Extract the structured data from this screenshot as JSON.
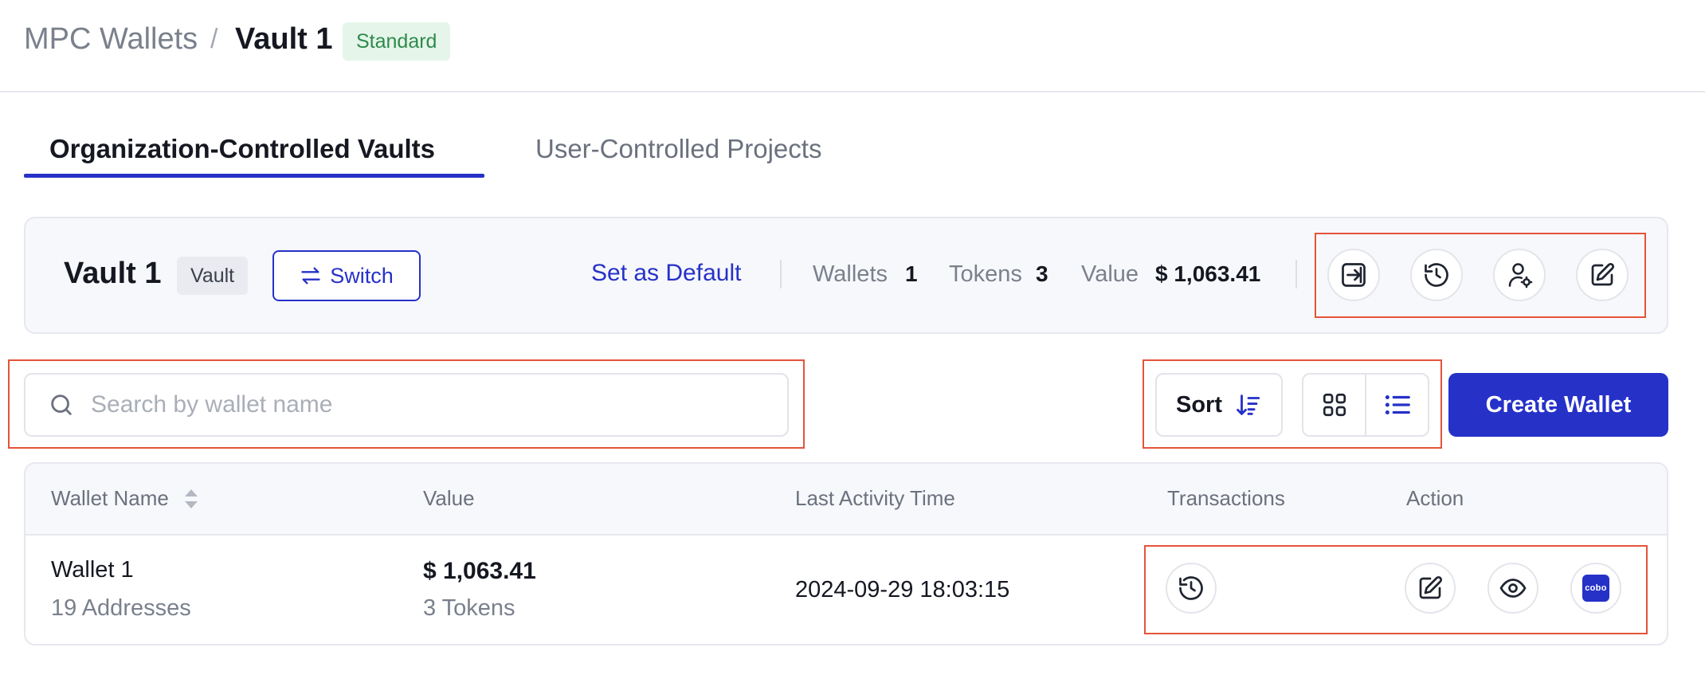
{
  "breadcrumb": {
    "root": "MPC Wallets",
    "separator": "/",
    "current": "Vault 1",
    "badge": "Standard"
  },
  "tabs": [
    {
      "label": "Organization-Controlled Vaults",
      "active": true
    },
    {
      "label": "User-Controlled Projects",
      "active": false
    }
  ],
  "vault": {
    "name": "Vault 1",
    "tag": "Vault",
    "switch_label": "Switch",
    "set_default_label": "Set as Default",
    "stats": {
      "wallets_label": "Wallets",
      "wallets_value": "1",
      "tokens_label": "Tokens",
      "tokens_value": "3",
      "value_label": "Value",
      "value_value": "$ 1,063.41"
    },
    "actions": [
      "import-icon",
      "history-icon",
      "user-settings-icon",
      "edit-icon"
    ]
  },
  "search": {
    "placeholder": "Search by wallet name",
    "value": ""
  },
  "toolbar": {
    "sort_label": "Sort",
    "create_label": "Create Wallet"
  },
  "table": {
    "columns": [
      "Wallet Name",
      "Value",
      "Last Activity Time",
      "Transactions",
      "Action"
    ],
    "rows": [
      {
        "name": "Wallet 1",
        "addresses": "19 Addresses",
        "value": "$ 1,063.41",
        "tokens": "3 Tokens",
        "last_activity": "2024-09-29 18:03:15",
        "brand_icon_text": "cobo"
      }
    ]
  },
  "colors": {
    "accent": "#2631c8",
    "badge_green_bg": "#e5f5ea",
    "badge_green_text": "#2f8a4b",
    "annotation_red": "#e5533a"
  }
}
